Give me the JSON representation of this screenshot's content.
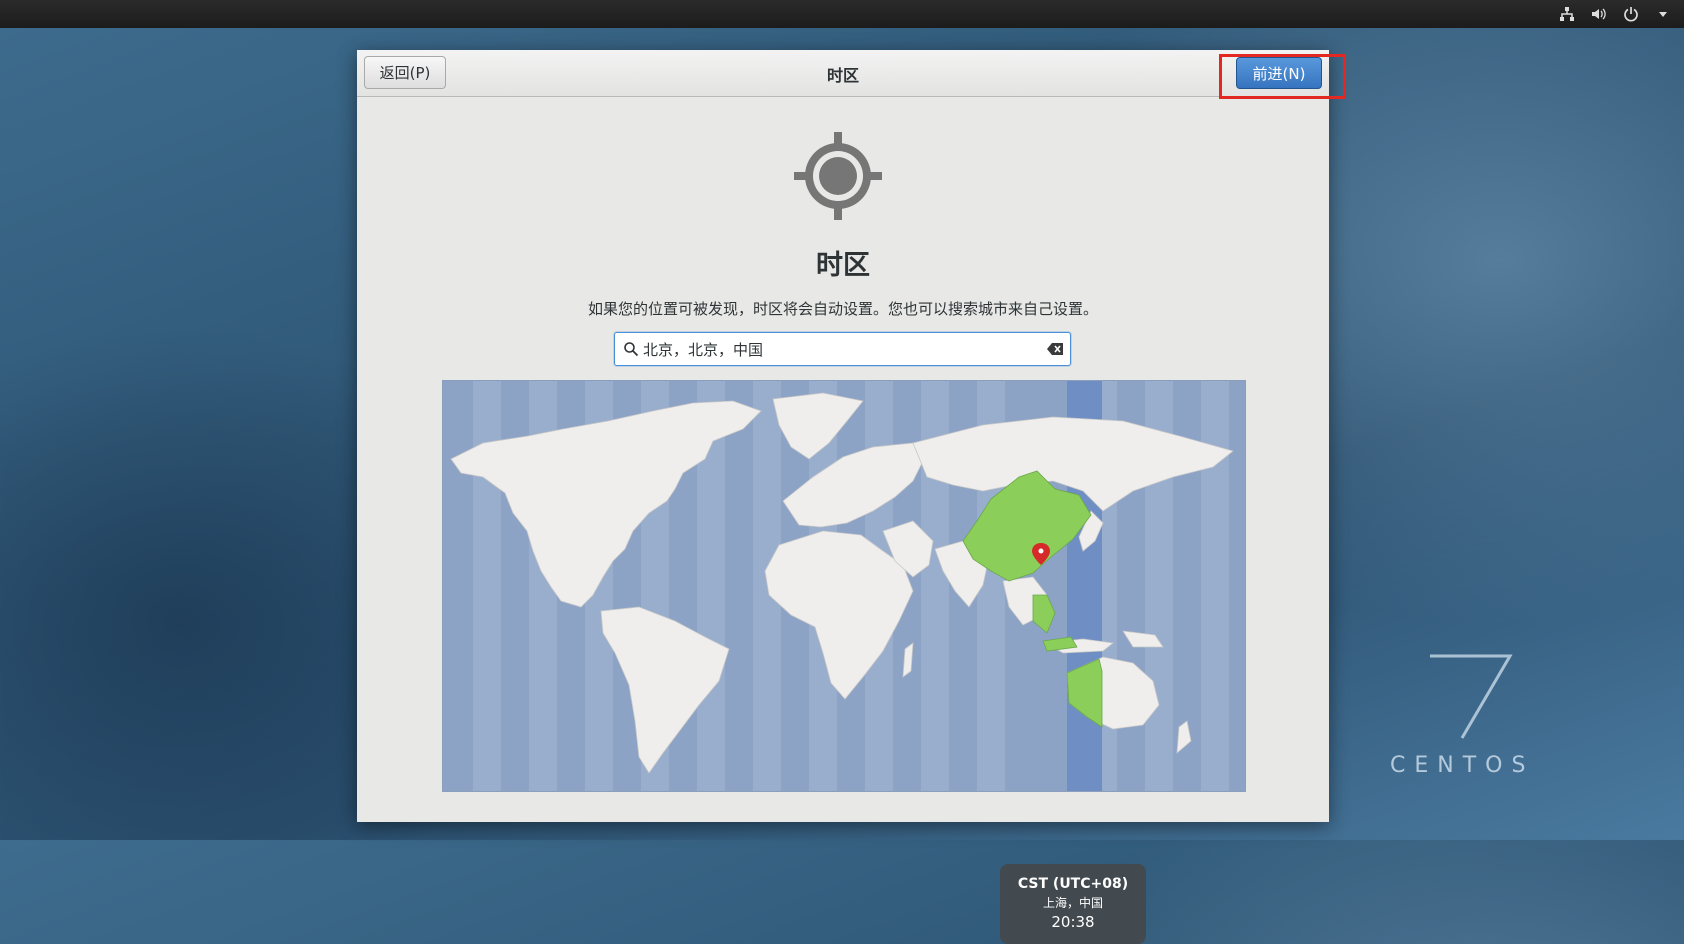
{
  "top_bar": {
    "icons": [
      "network-icon",
      "volume-icon",
      "power-icon",
      "menu-arrow-icon"
    ]
  },
  "header": {
    "back_label": "返回(P)",
    "title": "时区",
    "next_label": "前进(N)"
  },
  "main": {
    "icon": "location-target-icon",
    "title": "时区",
    "description": "如果您的位置可被发现，时区将会自动设置。您也可以搜索城市来自己设置。",
    "search_value": "北京，北京，中国"
  },
  "map": {
    "highlight_color": "#8cce5a",
    "tooltip": {
      "zone": "CST (UTC+08)",
      "location": "上海，中国",
      "time": "20:38"
    }
  },
  "branding": {
    "version": "7",
    "name": "CENTOS"
  },
  "colors": {
    "accent": "#3674c0",
    "highlight_border": "#e32822",
    "ocean": "#8ca3c6",
    "land": "#efeeec"
  }
}
